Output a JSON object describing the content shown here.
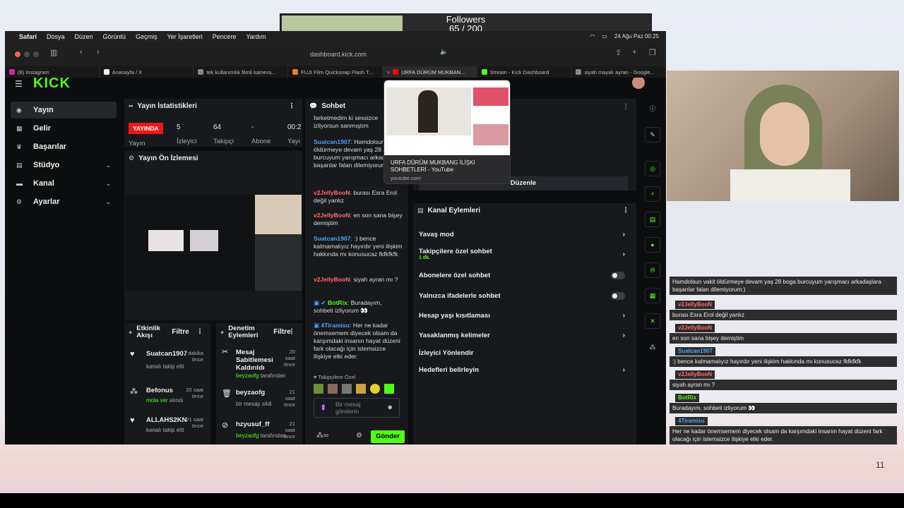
{
  "followers": {
    "title": "Followers",
    "count_text": "65 / 200",
    "progress": 0.325
  },
  "menubar": {
    "app": "Safari",
    "items": [
      "Dosya",
      "Düzen",
      "Görüntü",
      "Geçmiş",
      "Yer İşaretleri",
      "Pencere",
      "Yardım"
    ],
    "clock": "24 Ağu Paz  00:25"
  },
  "browser": {
    "url": "dashboard.kick.com",
    "tabs": [
      {
        "label": "(6) Instagram",
        "color": "#d6249f"
      },
      {
        "label": "Anasayfa / X",
        "color": "#eeeeee"
      },
      {
        "label": "tek kullanımlık filmli kamera...",
        "color": "#888888"
      },
      {
        "label": "FUJI Film Quicksnap Flash T...",
        "color": "#e87b2a"
      },
      {
        "label": "URFA DÜRÜM MUKBAN...",
        "color": "#ff0000",
        "active": true
      },
      {
        "label": "Stream - Kick Dashboard",
        "color": "#53fc18"
      },
      {
        "label": "siyah mayalı ayran - Google...",
        "color": "#888888"
      }
    ]
  },
  "kick": {
    "logo": "KICK",
    "nav": [
      {
        "label": "Yayın",
        "icon": "broadcast-icon",
        "active": true
      },
      {
        "label": "Gelir",
        "icon": "revenue-icon"
      },
      {
        "label": "Başarılar",
        "icon": "trophy-icon"
      },
      {
        "label": "Stüdyo",
        "icon": "studio-icon",
        "expandable": true
      },
      {
        "label": "Kanal",
        "icon": "channel-icon",
        "expandable": true
      },
      {
        "label": "Ayarlar",
        "icon": "settings-icon",
        "expandable": true
      }
    ],
    "stats": {
      "title": "Yayın İstatistikleri",
      "live_badge": "YAYINDA",
      "live_label": "Yayın",
      "viewers_value": "5",
      "viewers_label": "İzleyici",
      "followers_value": "64",
      "followers_label": "Takipçi",
      "subs_value": "-",
      "subs_label": "Abone",
      "time_value": "00:2",
      "time_label": "Yayı"
    },
    "preview_title": "Yayın Ön İzlemesi",
    "activity": {
      "title": "Etkinlik Akışı",
      "filter": "Filtre",
      "items": [
        {
          "name": "Suatcan1907",
          "sub": "kanalı takip etti",
          "time": "7 dakika önce"
        },
        {
          "name": "Befonus",
          "sub_highlight": "mola ver",
          "sub": " alındı",
          "time": "20 saat önce"
        },
        {
          "name": "ALLAHS2KN",
          "sub": "kanalı takip etti",
          "time": "21 saat önce"
        }
      ]
    },
    "moderation": {
      "title": "Denetim Eylemleri",
      "filter": "Filtre",
      "items": [
        {
          "name": "Mesaj Sabitlemesi Kaldırıldı",
          "sub_user": "beyzaofg",
          "sub": " tarafından",
          "time": "20 saat önce"
        },
        {
          "name": "beyzaofg",
          "sub": "bir mesajı sildi",
          "time": "21 saat önce"
        },
        {
          "name": "hzyusuf_ff",
          "sub_user": "beyzaofg",
          "sub": " tarafından",
          "time": "21 saat önce"
        }
      ]
    },
    "chat": {
      "title": "Sohbet",
      "messages": [
        {
          "user": "",
          "text": "farketmedim ki sessizce izliyorsun sanmıştım"
        },
        {
          "user": "Suatcan1907",
          "user_color": "#4aa3ff",
          "text": ": Hamdolsun vakit öldürmeye devam yaş 28 boga burcuyum yarışmacı arkadaşlara başarılar falan dilemiyorum:)"
        },
        {
          "user": "v2JellyBooN",
          "user_color": "#ff6b6b",
          "text": ": burası Esra Erol değil yanlız"
        },
        {
          "user": "v2JellyBooN",
          "user_color": "#ff6b6b",
          "text": ": en son sana bişey demiştim"
        },
        {
          "user": "Suatcan1907",
          "user_color": "#4aa3ff",
          "text": ": :) bence kalmamalıyız hayırdır yeni ilişkim hakkında mı konusucaz fkfkfkfk"
        },
        {
          "user": "v2JellyBooN",
          "user_color": "#ff6b6b",
          "text": ": siyah ayran mı ?"
        },
        {
          "user": "BotRix",
          "user_color": "#53fc18",
          "text": ": Buradayım, sohbeti izliyorum 👀"
        },
        {
          "user": "4Tiramisu",
          "user_color": "#4aa3ff",
          "text": ": Her ne kadar önemsemem diyecek olsam da karşımdaki insanın hayat düzeni fark olacağı için istemsizce ilişkiye etki eder."
        }
      ],
      "followers_only": "Takipçilere Özel",
      "input_placeholder": "Bir mesaj gönderin",
      "send": "Gönder"
    },
    "edit_button": "Düzenle",
    "channel_actions": {
      "title": "Kanal Eylemleri",
      "items": [
        {
          "label": "Yavaş mod",
          "control": "arrow"
        },
        {
          "label": "Takipçilere özel sohbet",
          "sub": "1 dk.",
          "control": "arrow"
        },
        {
          "label": "Abonelere özel sohbet",
          "control": "toggle"
        },
        {
          "label": "Yalnızca ifadelerle sohbet",
          "control": "toggle"
        },
        {
          "label": "Hesap yaşı kısıtlaması",
          "control": "arrow"
        },
        {
          "label": "Yasaklanmış kelimeler",
          "control": "arrow"
        },
        {
          "label": "İzleyici Yönlendir",
          "control": "none"
        },
        {
          "label": "Hedefleri belirleyin",
          "control": "arrow"
        }
      ]
    }
  },
  "hover_preview": {
    "title": "URFA DÜRÜM MUKBANG İLİŞKİ SOHBETLERİ - YouTube",
    "domain": "youtube.com"
  },
  "overlay_chat": [
    {
      "user": "",
      "text": "Hamdolsun vakit öldürmeye devam yaş 28 boga burcuyum yarışmacı arkadaşlara başarılar falan dilemiyorum:)"
    },
    {
      "user": "v2JellyBooN",
      "text": "burası Esra Erol değil yanlız"
    },
    {
      "user": "v2JellyBooN",
      "text": "en son sana bişey demiştim"
    },
    {
      "user": "Suatcan1907",
      "text": ":) bence kalmamalıyız hayırdır yeni ilişkim hakkında mı konusucaz fkfkfkfk"
    },
    {
      "user": "v2JellyBooN",
      "text": "siyah ayran mı ?"
    },
    {
      "user": "BotRix",
      "text": "Buradayım, sohbeti izliyorum 👀"
    },
    {
      "user": "4Tiramisu",
      "text": "Her ne kadar önemsemem diyecek olsam da karşımdaki insanın hayat düzeni fark olacağı için istemsizce ilişkiye etki eder."
    }
  ],
  "page_number": "11"
}
